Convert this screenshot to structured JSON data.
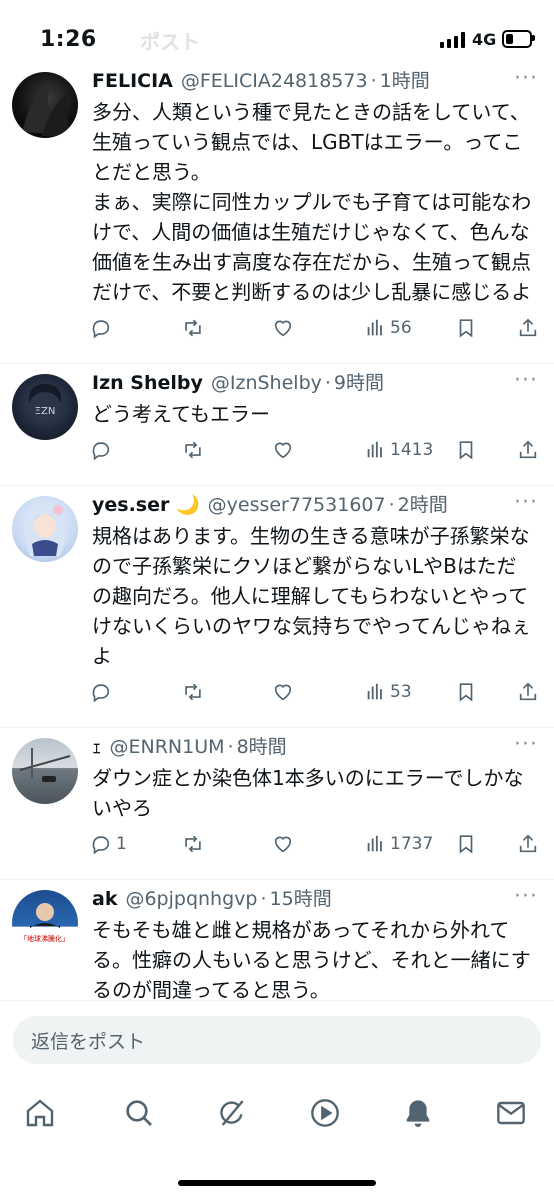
{
  "status_bar": {
    "time": "1:26",
    "network": "4G",
    "battery_level": 0.3
  },
  "faded_header": "ポスト",
  "tweets": [
    {
      "name": "FELICIA",
      "handle": "@FELICIA24818573",
      "time": "1時間",
      "text": "多分、人類という種で見たときの話をしていて、生殖っていう観点では、LGBTはエラー。ってことだと思う。\nまぁ、実際に同性カップルでも子育ては可能なわけで、人間の価値は生殖だけじゃなくて、色んな価値を生み出す高度な存在だから、生殖って観点だけで、不要と判断するのは少し乱暴に感じるよ",
      "replies": "",
      "views": "56"
    },
    {
      "name": "Izn Shelby",
      "handle": "@IznShelby",
      "time": "9時間",
      "text": "どう考えてもエラー",
      "replies": "",
      "views": "1413"
    },
    {
      "name": "yes.ser 🌙",
      "handle": "@yesser77531607",
      "time": "2時間",
      "text": "規格はあります。生物の生きる意味が子孫繁栄なので子孫繁栄にクソほど繋がらないLやBはただの趣向だろ。他人に理解してもらわないとやってけないくらいのヤワな気持ちでやってんじゃねぇよ",
      "replies": "",
      "views": "53"
    },
    {
      "name": "ｪ",
      "handle": "@ENRN1UM",
      "time": "8時間",
      "text": "ダウン症とか染色体1本多いのにエラーでしかないやろ",
      "replies": "1",
      "views": "1737"
    },
    {
      "name": "ak",
      "handle": "@6pjpqnhgvp",
      "time": "15時間",
      "text": "そもそも雄と雌と規格があってそれから外れてる。性癖の人もいると思うけど、それと一緒にするのが間違ってると思う。",
      "replies": "",
      "views": "",
      "avatar_caption": "「地球沸騰化」"
    }
  ],
  "reply_placeholder": "返信をポスト",
  "tabs": [
    "home-icon",
    "search-icon",
    "grok-icon",
    "video-icon",
    "notifications-icon",
    "messages-icon"
  ]
}
